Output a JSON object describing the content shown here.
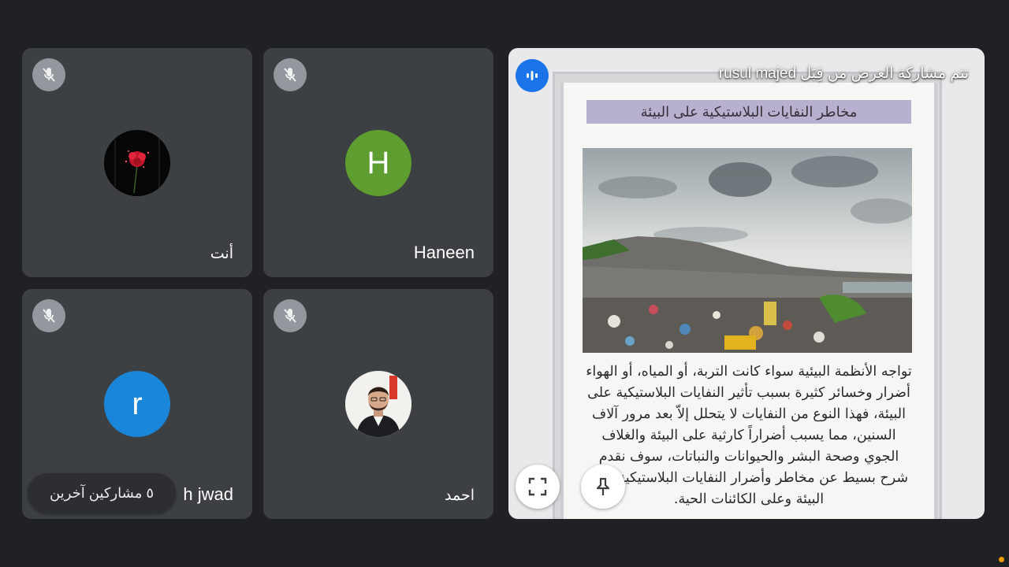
{
  "participants": [
    {
      "id": "you",
      "name": "أنت",
      "avatar_type": "flower-image"
    },
    {
      "id": "haneen",
      "name": "Haneen",
      "initial": "H",
      "avatar_color": "#5e9e31"
    },
    {
      "id": "r",
      "name": "h jwad",
      "initial": "r",
      "avatar_color": "#1a86d9"
    },
    {
      "id": "ahmed",
      "name": "احمد",
      "avatar_type": "photo"
    }
  ],
  "others_chip": {
    "label": "٥ مشاركين آخرين"
  },
  "presentation": {
    "caption": "تتم مشاركة العرض من قِبَل rusul majed",
    "slide": {
      "title": "مخاطر النفايات البلاستيكية على البيئة",
      "body_lines": [
        "تواجه الأنظمة البيئية سواء كانت التربة، أو المياه، أو الهواء",
        "أضرار وخسائر كثيرة بسبب تأثير النفايات البلاستيكية على",
        "البيئة، فهذا النوع من النفايات لا يتحلل إلاّ بعد مرور آلاف",
        "السنين، مما يسبب أضراراً كارثية على البيئة والغلاف",
        "الجوي وصحة البشر والحيوانات والنباتات، سوف نقدم",
        "شرح بسيط عن مخاطر وأضرار النفايات البلاستيكية على",
        "البيئة وعلى الكائنات الحية."
      ]
    }
  },
  "icons": {
    "mic_off": "mic-off-icon",
    "audio": "audio-level-icon",
    "fullscreen": "fullscreen-icon",
    "pin": "pin-icon"
  },
  "colors": {
    "background": "#202124",
    "tile": "#3c4043",
    "accent_blue": "#1a73e8"
  }
}
